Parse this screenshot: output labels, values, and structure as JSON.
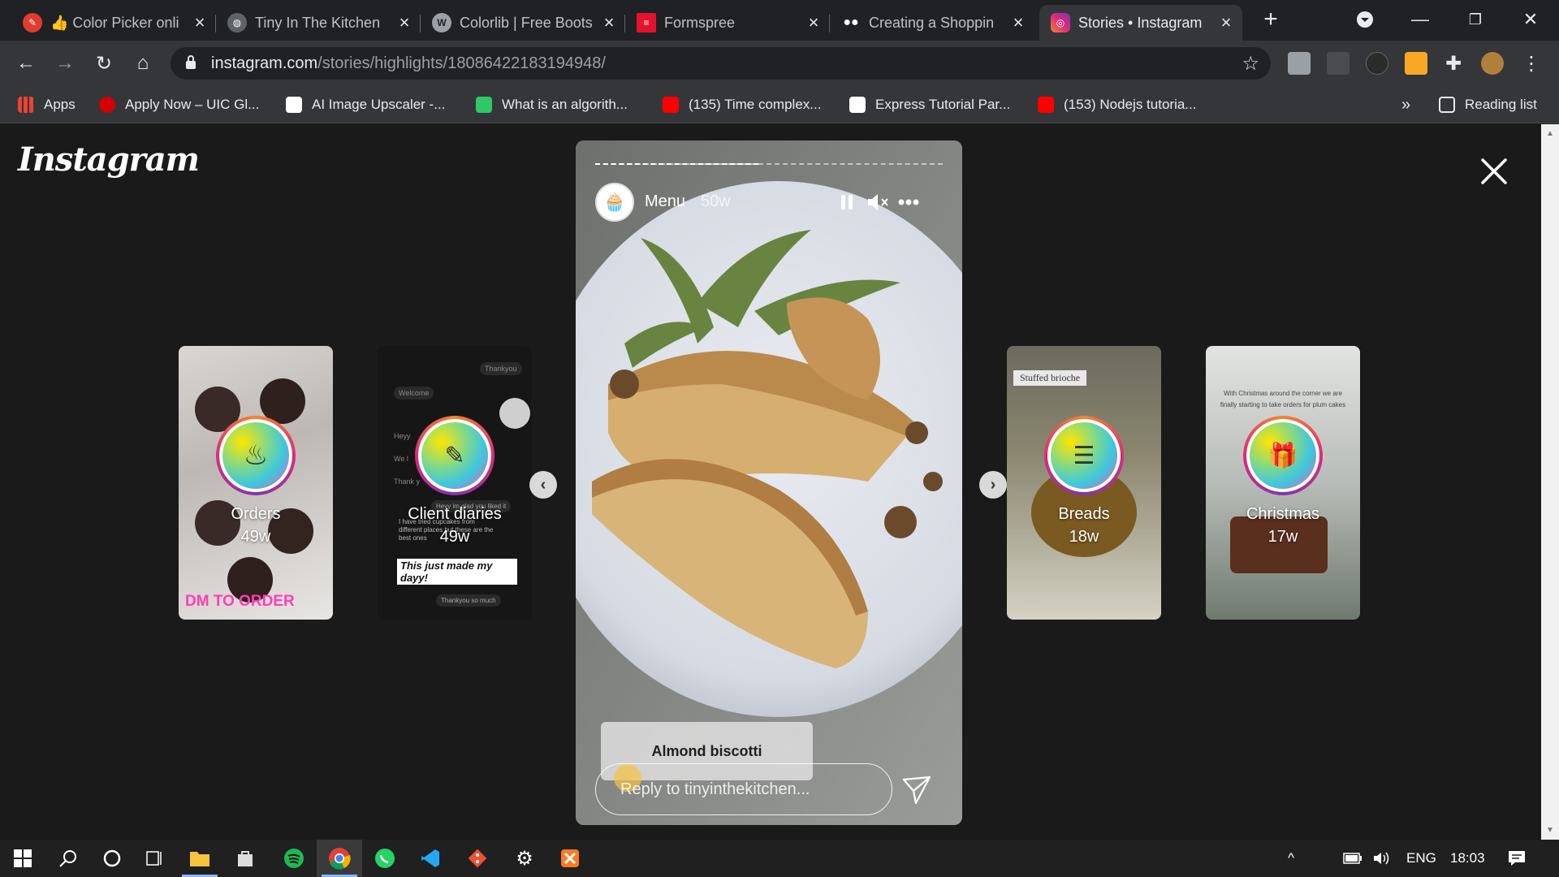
{
  "browser": {
    "tabs": [
      {
        "title": "👍 Color Picker onli",
        "favicon_color": "#e33b2e",
        "active": false
      },
      {
        "title": "Tiny In The Kitchen",
        "favicon_color": "#5f6368",
        "active": false
      },
      {
        "title": "Colorlib | Free Boots",
        "favicon_color": "#9aa0a6",
        "active": false
      },
      {
        "title": "Formspree",
        "favicon_color": "#e5122e",
        "active": false
      },
      {
        "title": "Creating a Shoppin",
        "favicon_color": "#ffffff",
        "active": false
      },
      {
        "title": "Stories • Instagram",
        "favicon_color": "#d6249f",
        "active": true
      }
    ],
    "new_tab_label": "+",
    "url_host": "instagram.com",
    "url_path": "/stories/highlights/18086422183194948/",
    "bookmarks": [
      {
        "label": "Apps",
        "color": "#ea4335"
      },
      {
        "label": "Apply Now – UIC Gl...",
        "color": "#d50000"
      },
      {
        "label": "AI Image Upscaler -...",
        "color": "#ffffff"
      },
      {
        "label": "What is an algorith...",
        "color": "#2ec866"
      },
      {
        "label": "(135) Time complex...",
        "color": "#ff0000"
      },
      {
        "label": "Express Tutorial Par...",
        "color": "#ffffff"
      },
      {
        "label": "(153) Nodejs tutoria...",
        "color": "#ff0000"
      }
    ],
    "bookmarks_overflow": "»",
    "reading_list": "Reading list"
  },
  "instagram": {
    "logo": "Instagram",
    "highlights_left": [
      {
        "name": "Orders",
        "age": "49w",
        "overlay": "DM TO ORDER"
      },
      {
        "name": "Client diaries",
        "age": "49w",
        "chat_lines": [
          "Thankyou",
          "Welcome",
          "Heyy",
          "We l",
          "Thank y",
          "Heyy im glad you liked it",
          "I have tried cupcakes from different places but these are the best ones",
          "This just made my dayy!",
          "Thankyou so much"
        ]
      }
    ],
    "highlights_right": [
      {
        "name": "Breads",
        "age": "18w",
        "overlay": "Stuffed brioche"
      },
      {
        "name": "Christmas",
        "age": "17w",
        "overlay": "With Christmas around the corner we are finally starting to take orders for plum cakes"
      }
    ],
    "story": {
      "title": "Menu",
      "age": "50w",
      "progress": 0.47,
      "caption": "Almond biscotti",
      "reply_placeholder": "Reply to tinyinthekitchen..."
    },
    "nav_prev": "‹",
    "nav_next": "›"
  },
  "taskbar": {
    "apps": [
      "start",
      "search",
      "cortana",
      "task-view",
      "file-explorer",
      "store",
      "spotify",
      "chrome",
      "whatsapp",
      "vscode",
      "git",
      "settings",
      "xampp"
    ],
    "active_app": "chrome",
    "tray": {
      "chevron": "^",
      "lang": "ENG",
      "time": "18:03"
    }
  }
}
